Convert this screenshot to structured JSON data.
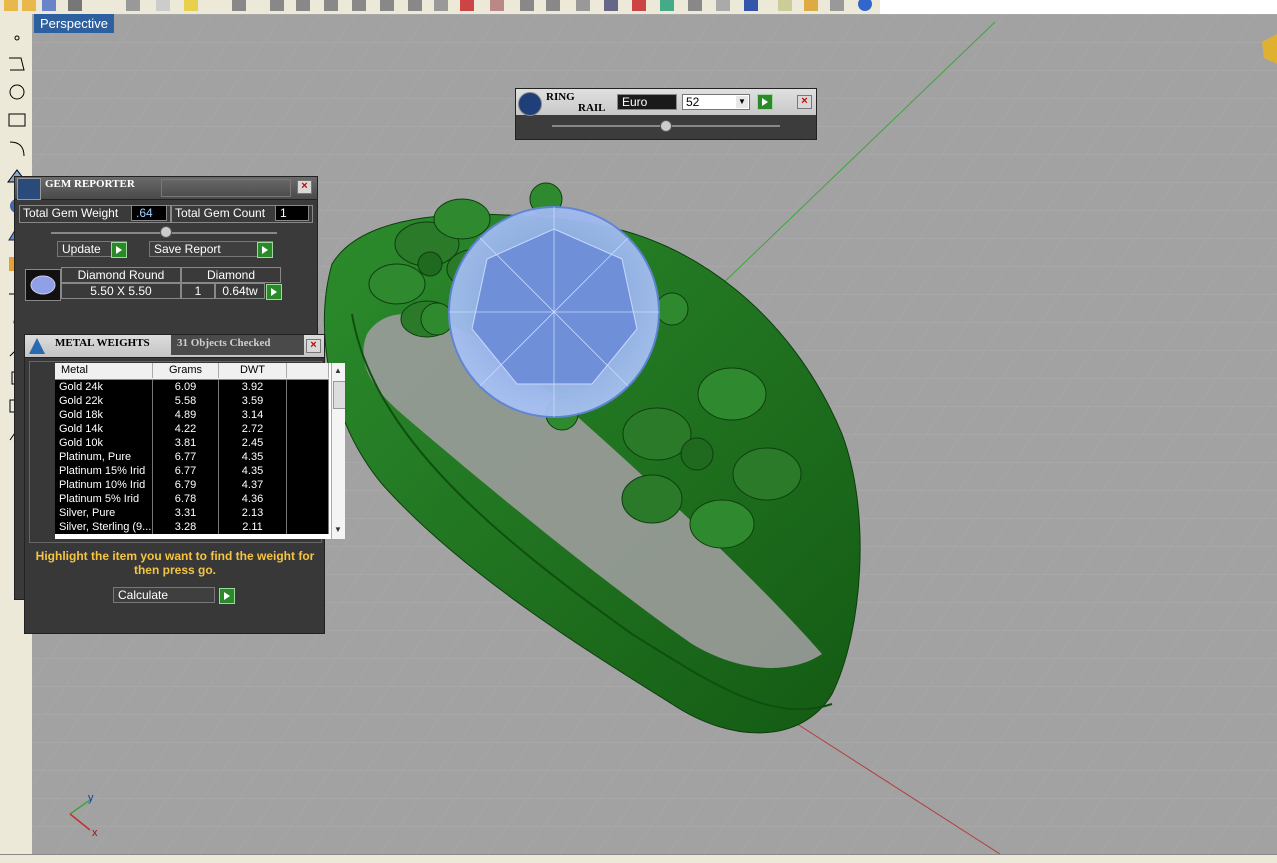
{
  "viewport": {
    "label": "Perspective",
    "axes": {
      "x": "x",
      "y": "y"
    }
  },
  "ring_rail": {
    "title_line1": "RING",
    "title_line2": "RAIL",
    "size_system": "Euro",
    "size_value": "52"
  },
  "gem_reporter": {
    "title": "GEM REPORTER",
    "total_weight_label": "Total Gem Weight",
    "total_weight_value": ".64",
    "total_count_label": "Total Gem Count",
    "total_count_value": "1",
    "update_label": "Update",
    "save_report_label": "Save Report",
    "gem": {
      "shape": "Diamond Round",
      "size": "5.50 X 5.50",
      "material": "Diamond",
      "count": "1",
      "weight": "0.64tw"
    }
  },
  "metal_weights": {
    "title": "METAL WEIGHTS",
    "objects_checked": "31 Objects Checked",
    "columns": [
      "Metal",
      "Grams",
      "DWT",
      ""
    ],
    "rows": [
      [
        "Gold 24k",
        "6.09",
        "3.92"
      ],
      [
        "Gold 22k",
        "5.58",
        "3.59"
      ],
      [
        "Gold 18k",
        "4.89",
        "3.14"
      ],
      [
        "Gold 14k",
        "4.22",
        "2.72"
      ],
      [
        "Gold 10k",
        "3.81",
        "2.45"
      ],
      [
        "Platinum, Pure",
        "6.77",
        "4.35"
      ],
      [
        "Platinum 15% Irid",
        "6.77",
        "4.35"
      ],
      [
        "Platinum 10% Irid",
        "6.79",
        "4.37"
      ],
      [
        "Platinum 5% Irid",
        "6.78",
        "4.36"
      ],
      [
        "Silver, Pure",
        "3.31",
        "2.13"
      ],
      [
        "Silver, Sterling (9...",
        "3.28",
        "2.11"
      ]
    ],
    "instruction": "Highlight the item you want to find the weight for then press go.",
    "calculate_label": "Calculate"
  },
  "colors": {
    "panel_bg": "#3a3a3a",
    "go_green": "#2a8a2a",
    "instruction_text": "#f5c542",
    "ring_green": "#1f7a1f",
    "gem_blue": "#8fb0f0"
  }
}
